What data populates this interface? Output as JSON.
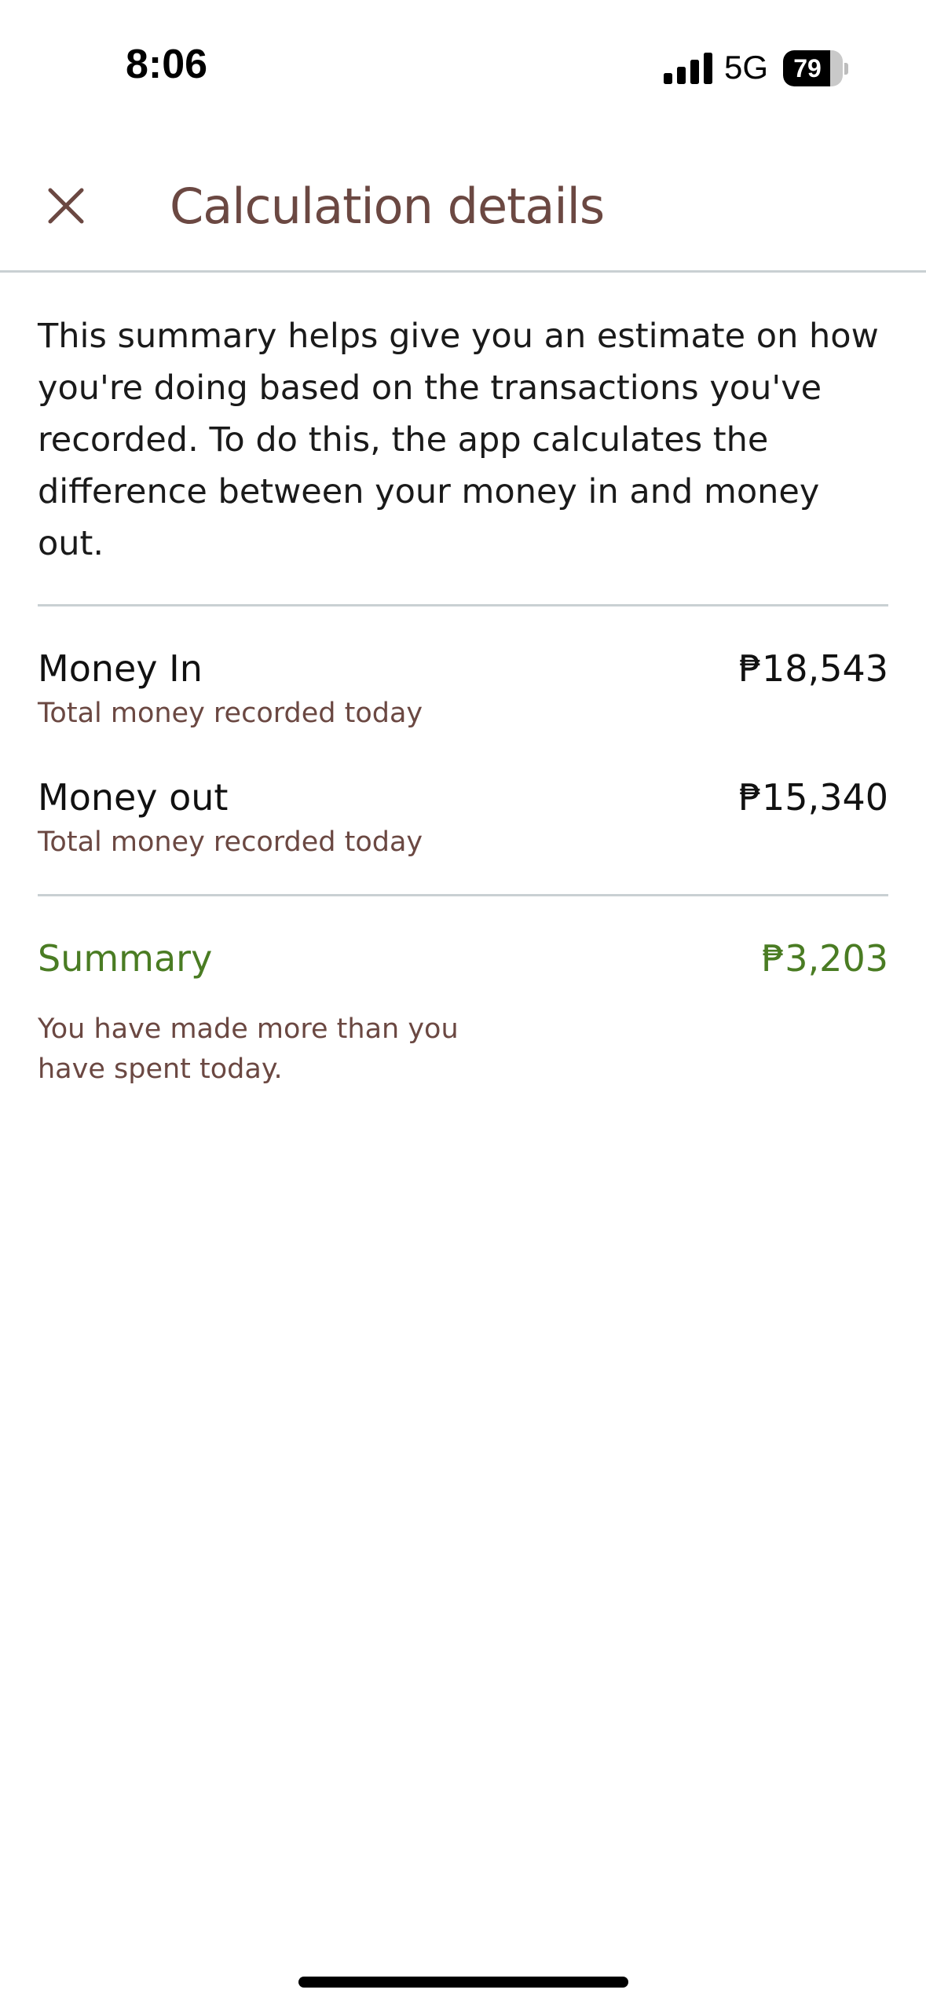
{
  "status_bar": {
    "time": "8:06",
    "network": "5G",
    "battery_level": "79",
    "battery_fraction": 0.79
  },
  "header": {
    "title": "Calculation details",
    "close_icon": "close-icon"
  },
  "intro_text": "This summary helps give you an estimate on how you're doing based on the transactions you've recorded. To do this, the app calculates the difference between your money in and money out.",
  "rows": [
    {
      "title": "Money In",
      "subtitle": "Total money recorded today",
      "amount": "₱18,543"
    },
    {
      "title": "Money out",
      "subtitle": "Total money recorded today",
      "amount": "₱15,340"
    }
  ],
  "summary": {
    "title": "Summary",
    "amount": "₱3,203",
    "note": "You have made more than you have spent today."
  },
  "colors": {
    "title_brown": "#6b4842",
    "summary_green": "#4a7c23",
    "divider": "#c9d0d3"
  }
}
